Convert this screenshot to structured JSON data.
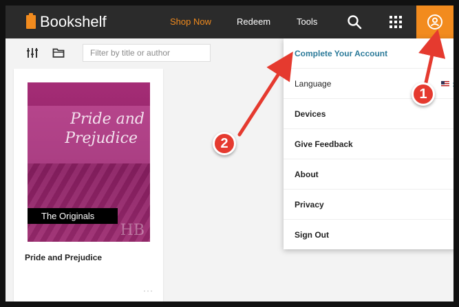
{
  "app": {
    "brand": "Bookshelf",
    "accent_color": "#f28b1e"
  },
  "nav": {
    "shop_now": "Shop Now",
    "redeem": "Redeem",
    "tools": "Tools"
  },
  "toolbar": {
    "filter_placeholder": "Filter by title or author",
    "filter_value": ""
  },
  "book": {
    "cover_title_line1": "Pride and",
    "cover_title_line2": "Prejudice",
    "cover_series": "The Originals",
    "cover_mark": "HB",
    "title": "Pride and Prejudice",
    "more": "···"
  },
  "menu": {
    "items": [
      {
        "label": "Complete Your Account"
      },
      {
        "label": "Language"
      },
      {
        "label": "Devices"
      },
      {
        "label": "Give Feedback"
      },
      {
        "label": "About"
      },
      {
        "label": "Privacy"
      },
      {
        "label": "Sign Out"
      }
    ],
    "language_chevron": "›"
  },
  "annotations": {
    "step1": "1",
    "step2": "2",
    "color": "#e53a2f"
  },
  "icons": [
    "book-logo-icon",
    "search-icon",
    "apps-grid-icon",
    "account-icon",
    "sort-sliders-icon",
    "folder-icon",
    "flag-icon",
    "chevron-right-icon"
  ]
}
